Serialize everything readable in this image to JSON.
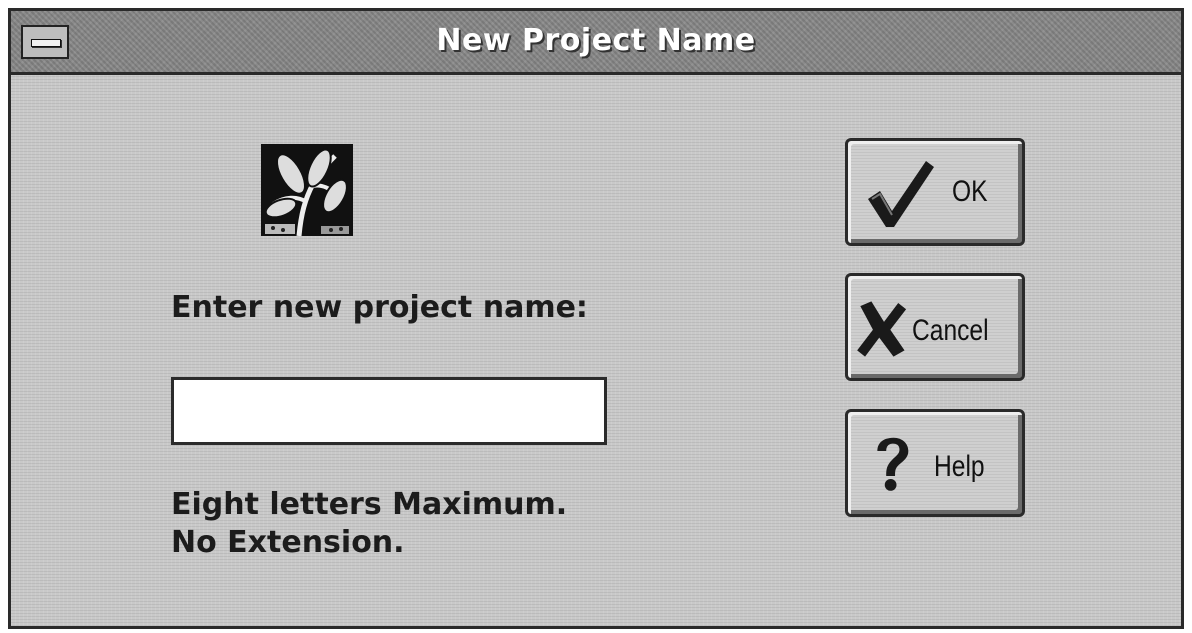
{
  "window": {
    "title": "New Project Name"
  },
  "form": {
    "prompt": "Enter new project name:",
    "input_value": "",
    "hint_line1": "Eight letters Maximum.",
    "hint_line2": "No Extension."
  },
  "buttons": {
    "ok": {
      "label": "OK",
      "icon": "checkmark-icon"
    },
    "cancel": {
      "label": "Cancel",
      "icon": "x-mark-icon"
    },
    "help": {
      "label": "Help",
      "icon": "question-mark-icon"
    }
  },
  "icons": {
    "system_menu": "system-menu-icon",
    "logo": "plant-leaves-logo"
  }
}
